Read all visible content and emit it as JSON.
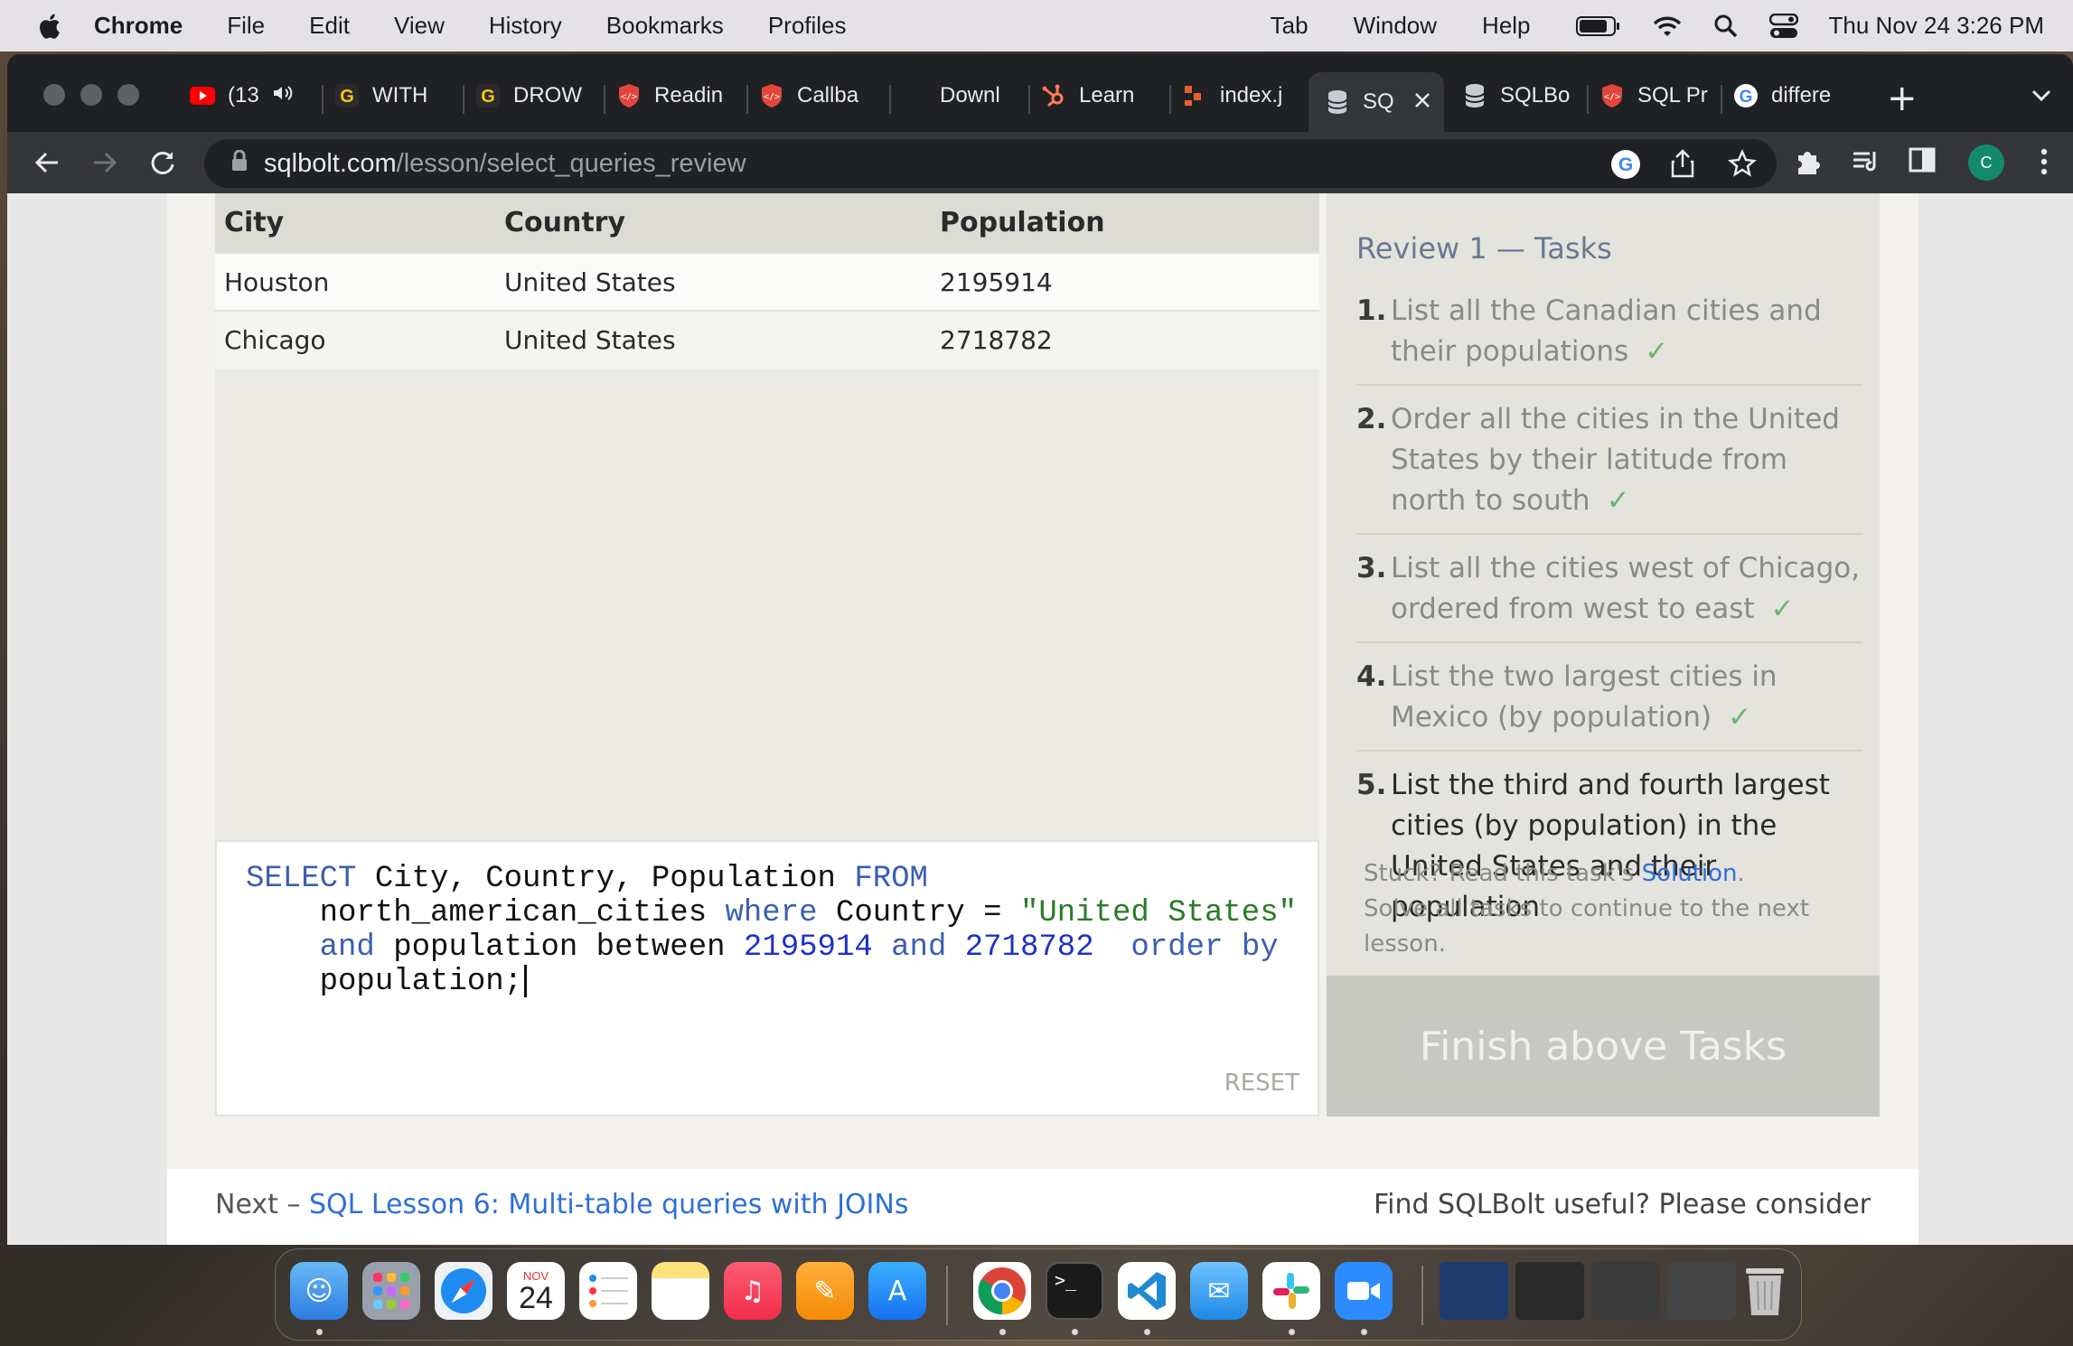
{
  "menubar": {
    "app_name": "Chrome",
    "items": [
      "File",
      "Edit",
      "View",
      "History",
      "Bookmarks",
      "Profiles"
    ],
    "right_items": [
      "Tab",
      "Window",
      "Help"
    ],
    "clock": "Thu Nov 24  3:26 PM"
  },
  "tabs": [
    {
      "label": "(13",
      "icon": "youtube-icon"
    },
    {
      "label": "WITH",
      "icon": "g-icon"
    },
    {
      "label": "DROW",
      "icon": "g-icon"
    },
    {
      "label": "Readin",
      "icon": "code-shield-icon"
    },
    {
      "label": "Callba",
      "icon": "code-shield-icon"
    },
    {
      "label": "Downl",
      "icon": "page-icon"
    },
    {
      "label": "Learn",
      "icon": "hubspot-icon"
    },
    {
      "label": "index.j",
      "icon": "orange-blocks-icon"
    },
    {
      "label": "SQ",
      "icon": "database-icon"
    },
    {
      "label": "SQLBo",
      "icon": "database-icon"
    },
    {
      "label": "SQL Pr",
      "icon": "code-shield-icon"
    },
    {
      "label": "differe",
      "icon": "google-icon"
    }
  ],
  "address_bar": {
    "host": "sqlbolt.com",
    "path": "/lesson/select_queries_review"
  },
  "profile_initial": "C",
  "results": {
    "columns": [
      "City",
      "Country",
      "Population"
    ],
    "rows": [
      [
        "Houston",
        "United States",
        "2195914"
      ],
      [
        "Chicago",
        "United States",
        "2718782"
      ]
    ]
  },
  "editor": {
    "tokens": {
      "select": "SELECT",
      "cols": " City, Country, Population ",
      "from": "FROM",
      "table": "north_american_cities ",
      "where": "where",
      "cond": " Country = ",
      "str": "\"United States\"",
      "and1": "and",
      "pop": " population between ",
      "n1": "2195914",
      "and2": "and",
      "n2": "2718782",
      "order": "order by",
      "last": "population;"
    },
    "reset_label": "RESET"
  },
  "tasks": {
    "title": "Review 1 — Tasks",
    "items": [
      {
        "num": "1.",
        "text": "List all the Canadian cities and their populations",
        "check": "✓"
      },
      {
        "num": "2.",
        "text": "Order all the cities in the United States by their latitude from north to south",
        "check": "✓"
      },
      {
        "num": "3.",
        "text": "List all the cities west of Chicago, ordered from west to east",
        "check": "✓"
      },
      {
        "num": "4.",
        "text": "List the two largest cities in Mexico (by population)",
        "check": "✓"
      },
      {
        "num": "5.",
        "text": "List the third and fourth largest cities (by population) in the United States and their population"
      }
    ],
    "help_prefix": "Stuck? Read this task's ",
    "help_link": "Solution",
    "help_suffix": ".",
    "help_line2": "Solve all tasks to continue to the next lesson.",
    "finish_label": "Finish above Tasks"
  },
  "footer": {
    "next_prefix": "Next – ",
    "next_link": "SQL Lesson 6: Multi-table queries with JOINs",
    "useful": "Find SQLBolt useful? Please consider"
  },
  "dock": {
    "calendar_month": "NOV",
    "calendar_day": "24"
  }
}
